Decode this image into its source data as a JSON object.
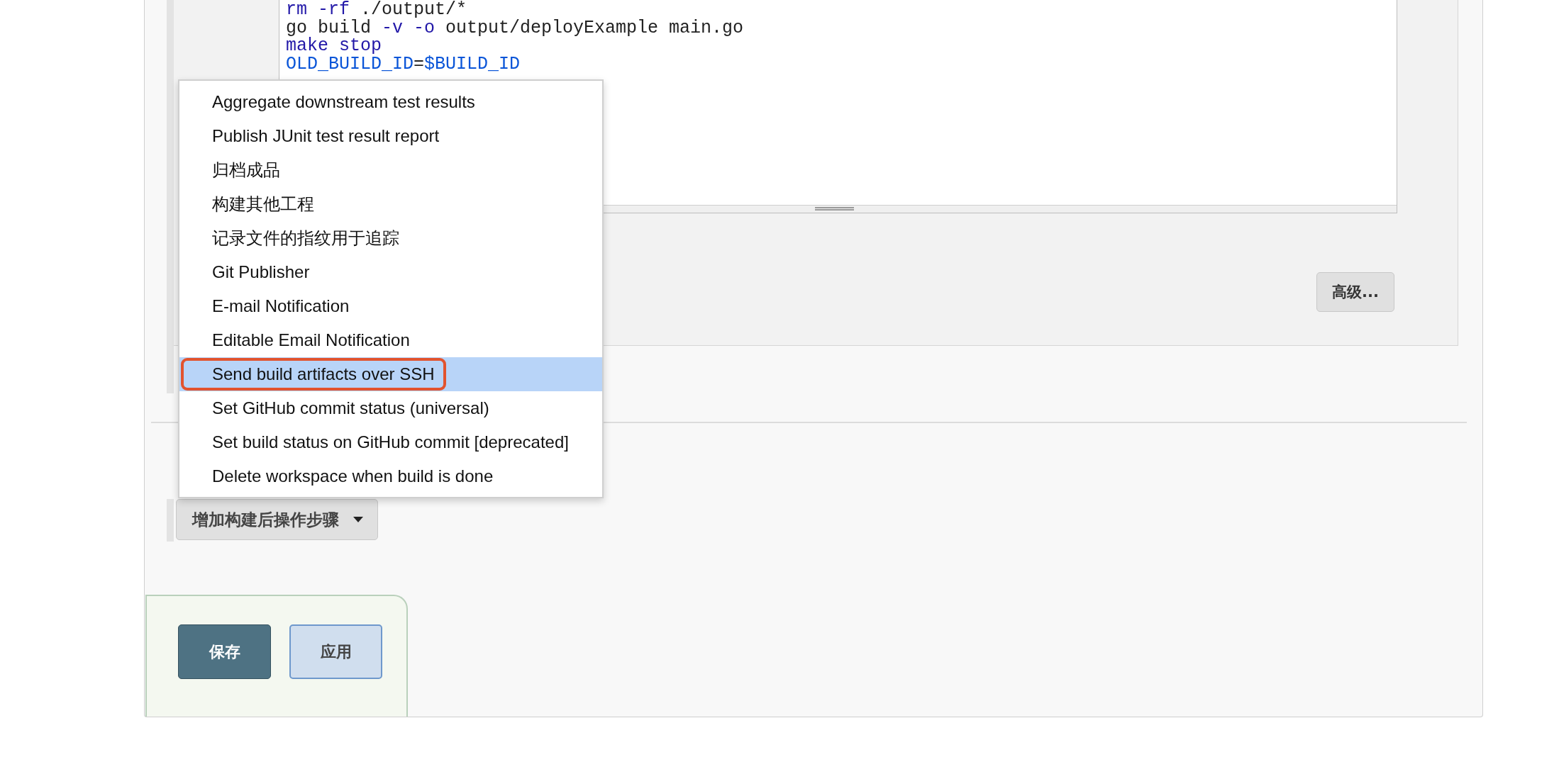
{
  "editor": {
    "lines": [
      [
        {
          "kind": "keyword",
          "text": "rm -rf"
        },
        {
          "kind": "plain",
          "text": " ./output/*"
        }
      ],
      [
        {
          "kind": "plain",
          "text": "go build "
        },
        {
          "kind": "keyword",
          "text": "-v -o"
        },
        {
          "kind": "plain",
          "text": " output/deployExample main.go"
        }
      ],
      [
        {
          "kind": "keyword",
          "text": "make stop"
        }
      ],
      [
        {
          "kind": "variable",
          "text": "OLD_BUILD_ID"
        },
        {
          "kind": "plain",
          "text": "="
        },
        {
          "kind": "variable",
          "text": "$BUILD_ID"
        }
      ]
    ]
  },
  "advanced_button": "高级...",
  "menu": {
    "items": [
      {
        "label": "Aggregate downstream test results",
        "selected": false,
        "annotated": false
      },
      {
        "label": "Publish JUnit test result report",
        "selected": false,
        "annotated": false
      },
      {
        "label": "归档成品",
        "selected": false,
        "annotated": false
      },
      {
        "label": "构建其他工程",
        "selected": false,
        "annotated": false
      },
      {
        "label": "记录文件的指纹用于追踪",
        "selected": false,
        "annotated": false
      },
      {
        "label": "Git Publisher",
        "selected": false,
        "annotated": false
      },
      {
        "label": "E-mail Notification",
        "selected": false,
        "annotated": false
      },
      {
        "label": "Editable Email Notification",
        "selected": false,
        "annotated": false
      },
      {
        "label": "Send build artifacts over SSH",
        "selected": true,
        "annotated": true
      },
      {
        "label": "Set GitHub commit status (universal)",
        "selected": false,
        "annotated": false
      },
      {
        "label": "Set build status on GitHub commit [deprecated]",
        "selected": false,
        "annotated": false
      },
      {
        "label": "Delete workspace when build is done",
        "selected": false,
        "annotated": false
      }
    ]
  },
  "add_step_button": "增加构建后操作步骤",
  "buttons": [
    {
      "kind": "primary",
      "label": "保存"
    },
    {
      "kind": "secondary",
      "label": "应用"
    }
  ]
}
